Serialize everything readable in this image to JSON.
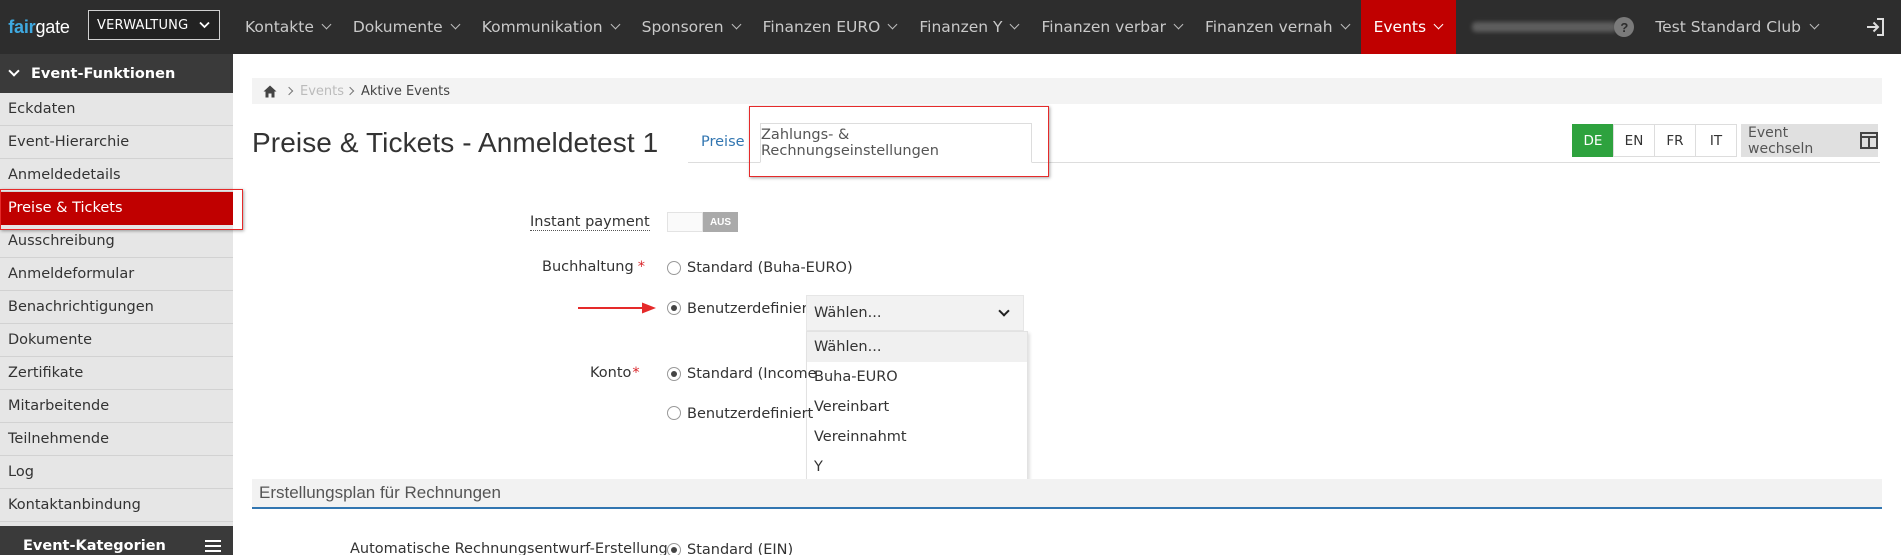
{
  "logo": {
    "part1": "fair",
    "part2": "gate"
  },
  "header": {
    "role_select": "VERWALTUNG",
    "nav": [
      {
        "label": "Kontakte"
      },
      {
        "label": "Dokumente"
      },
      {
        "label": "Kommunikation"
      },
      {
        "label": "Sponsoren"
      },
      {
        "label": "Finanzen EURO"
      },
      {
        "label": "Finanzen Y"
      },
      {
        "label": "Finanzen verbar"
      },
      {
        "label": "Finanzen vernah"
      },
      {
        "label": "Events"
      }
    ],
    "help": "?",
    "club": "Test Standard Club"
  },
  "sidebar": {
    "title": "Event-Funktionen",
    "items": [
      {
        "label": "Eckdaten"
      },
      {
        "label": "Event-Hierarchie"
      },
      {
        "label": "Anmeldedetails"
      },
      {
        "label": "Preise & Tickets"
      },
      {
        "label": "Ausschreibung"
      },
      {
        "label": "Anmeldeformular"
      },
      {
        "label": "Benachrichtigungen"
      },
      {
        "label": "Dokumente"
      },
      {
        "label": "Zertifikate"
      },
      {
        "label": "Mitarbeitende"
      },
      {
        "label": "Teilnehmende"
      },
      {
        "label": "Log"
      },
      {
        "label": "Kontaktanbindung"
      }
    ],
    "footer": "Event-Kategorien"
  },
  "breadcrumb": {
    "level1": "Events",
    "level2": "Aktive Events"
  },
  "page_title": "Preise & Tickets - Anmeldetest 1",
  "tabs": {
    "preise": "Preise",
    "zahlung": "Zahlungs- & Rechnungseinstellungen"
  },
  "languages": [
    "DE",
    "EN",
    "FR",
    "IT"
  ],
  "event_switch": "Event wechseln",
  "form": {
    "instant_payment": {
      "label": "Instant payment",
      "toggle": "AUS"
    },
    "buchhaltung": {
      "label": "Buchhaltung",
      "required": "*",
      "option_standard": "Standard (Buha-EURO)",
      "option_custom": "Benutzerdefiniert",
      "select_value": "Wählen...",
      "dropdown": [
        "Wählen...",
        "Buha-EURO",
        "Vereinbart",
        "Vereinnahmt",
        "Y"
      ]
    },
    "konto": {
      "label": "Konto",
      "required": "*",
      "option_standard": "Standard (Income",
      "option_custom": "Benutzerdefiniert"
    }
  },
  "section": {
    "title": "Erstellungsplan für Rechnungen"
  },
  "auto_draft": {
    "label": "Automatische Rechnungsentwurf-Erstellung",
    "option": "Standard (EIN)"
  },
  "colors": {
    "accent_red": "#c00000",
    "topbar": "#2d2d2d",
    "lang_active": "#2ea23e",
    "link_blue": "#3276b1"
  }
}
